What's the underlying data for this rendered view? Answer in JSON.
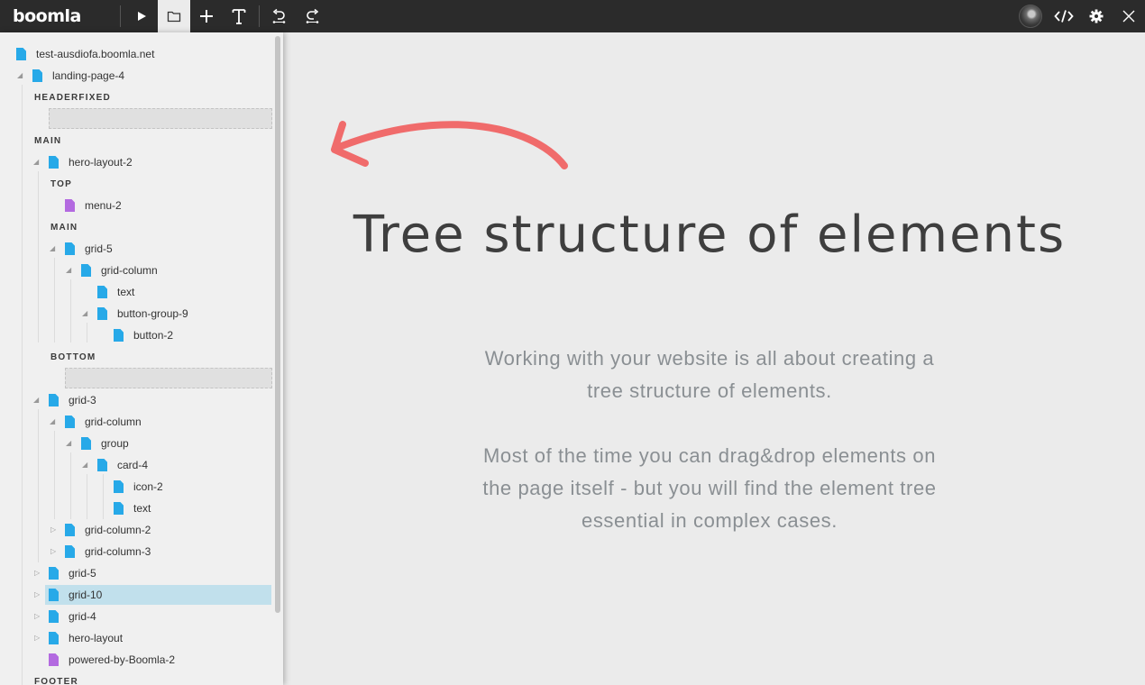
{
  "app": {
    "logo": "boomla"
  },
  "toolbar": {
    "play": "play-icon",
    "files": "folder-icon",
    "add": "plus-icon",
    "text": "text-icon",
    "undo": "undo-icon",
    "redo": "redo-icon",
    "code": "code-icon",
    "settings": "gear-icon",
    "close": "close-icon"
  },
  "tree": {
    "root": "test-ausdiofa.boomla.net",
    "page": "landing-page-4",
    "slot_headerfixed": "HEADERFIXED",
    "slot_main": "MAIN",
    "hero": "hero-layout-2",
    "slot_top": "TOP",
    "menu": "menu-2",
    "slot_main_inner": "MAIN",
    "grid5": "grid-5",
    "grid_column": "grid-column",
    "text1": "text",
    "button_group": "button-group-9",
    "button": "button-2",
    "slot_bottom": "BOTTOM",
    "grid3": "grid-3",
    "grid3_column": "grid-column",
    "group": "group",
    "card": "card-4",
    "icon": "icon-2",
    "text2": "text",
    "grid_column_2": "grid-column-2",
    "grid_column_3": "grid-column-3",
    "grid5b": "grid-5",
    "grid10": "grid-10",
    "grid4": "grid-4",
    "hero_layout": "hero-layout",
    "powered": "powered-by-Boomla-2",
    "slot_footer": "FOOTER"
  },
  "main": {
    "heading": "Tree structure of elements",
    "para1_line1": "Working with your website is all about creating a",
    "para1_line2": "tree structure of elements.",
    "para2_line1": "Most of the time you can drag&drop elements on",
    "para2_line2": "the page itself - but you will find the element tree",
    "para2_line3": "essential in complex cases."
  },
  "colors": {
    "toolbar_bg": "#2b2b2b",
    "file_blue": "#27a9e8",
    "file_purple": "#b36ae0",
    "selected_row": "#c1e0ec",
    "arrow": "#f06b6b"
  }
}
